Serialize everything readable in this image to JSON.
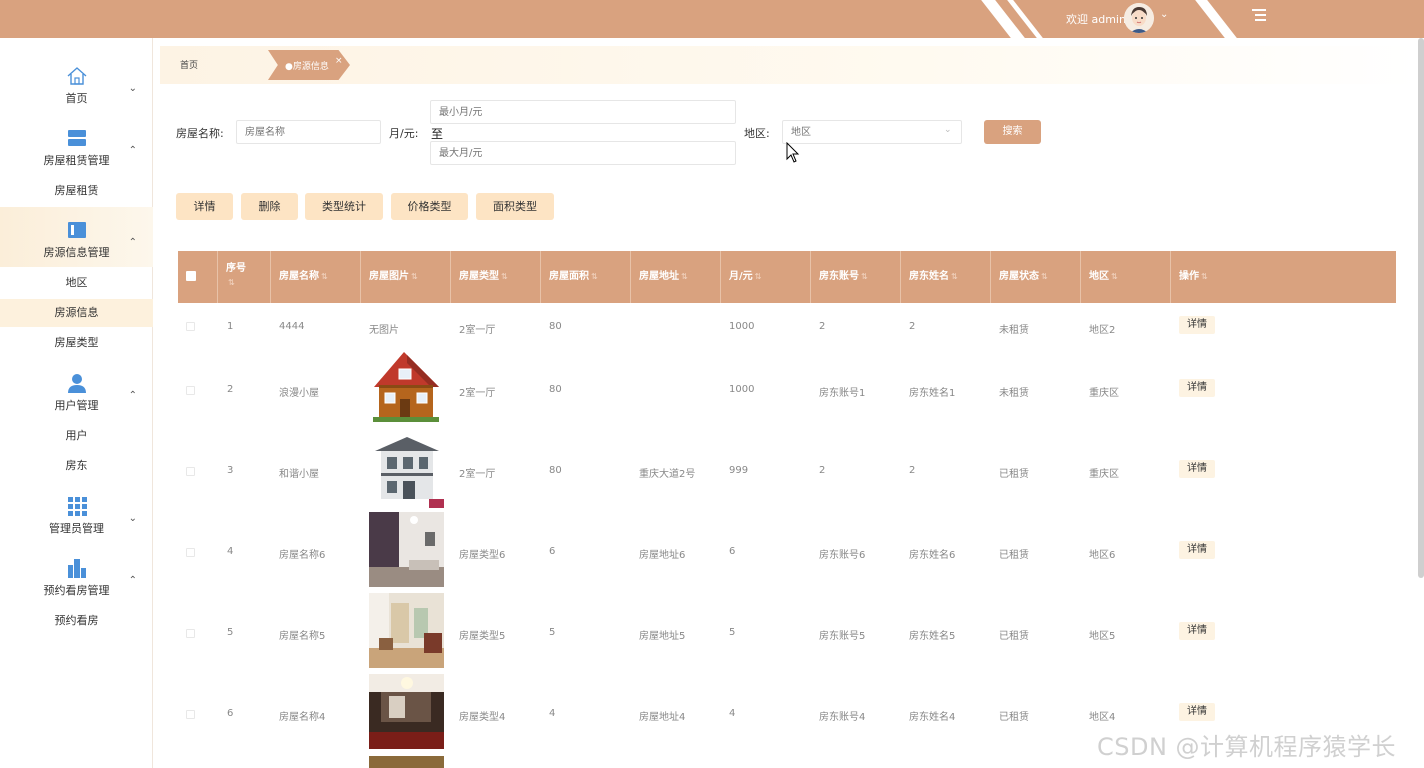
{
  "header": {
    "welcome": "欢迎 admin",
    "accent_color": "#d9a27f"
  },
  "sidebar": {
    "groups": [
      {
        "label": "首页",
        "icon": "home-icon",
        "chevron": "down"
      },
      {
        "label": "房屋租赁管理",
        "icon": "database-icon",
        "chevron": "up",
        "items": [
          "房屋租赁"
        ]
      },
      {
        "label": "房源信息管理",
        "icon": "panel-icon",
        "chevron": "up",
        "items": [
          "地区",
          "房源信息",
          "房屋类型"
        ],
        "active_item": "房源信息"
      },
      {
        "label": "用户管理",
        "icon": "user-icon",
        "chevron": "up",
        "items": [
          "用户",
          "房东"
        ]
      },
      {
        "label": "管理员管理",
        "icon": "grid-icon",
        "chevron": "down"
      },
      {
        "label": "预约看房管理",
        "icon": "building-icon",
        "chevron": "up",
        "items": [
          "预约看房"
        ]
      }
    ]
  },
  "breadcrumb": {
    "home": "首页",
    "current": "●房源信息",
    "close": "×"
  },
  "search": {
    "name_label": "房屋名称:",
    "name_placeholder": "房屋名称",
    "price_label": "月/元:",
    "min_placeholder": "最小月/元",
    "to": "至",
    "max_placeholder": "最大月/元",
    "region_label": "地区:",
    "region_placeholder": "地区",
    "button": "搜索"
  },
  "actions": [
    "详情",
    "删除",
    "类型统计",
    "价格类型",
    "面积类型"
  ],
  "table": {
    "columns": [
      "序号",
      "房屋名称",
      "房屋图片",
      "房屋类型",
      "房屋面积",
      "房屋地址",
      "月/元",
      "房东账号",
      "房东姓名",
      "房屋状态",
      "地区",
      "操作"
    ],
    "action_label": "详情",
    "rows": [
      {
        "no": "1",
        "name": "4444",
        "image": "无图片",
        "type": "2室一厅",
        "area": "80",
        "address": "",
        "price": "1000",
        "account": "2",
        "owner": "2",
        "status": "未租赁",
        "region": "地区2"
      },
      {
        "no": "2",
        "name": "浪漫小屋",
        "image": "house-image",
        "type": "2室一厅",
        "area": "80",
        "address": "",
        "price": "1000",
        "account": "房东账号1",
        "owner": "房东姓名1",
        "status": "未租赁",
        "region": "重庆区"
      },
      {
        "no": "3",
        "name": "和谐小屋",
        "image": "villa-image",
        "type": "2室一厅",
        "area": "80",
        "address": "重庆大道2号",
        "price": "999",
        "account": "2",
        "owner": "2",
        "status": "已租赁",
        "region": "重庆区"
      },
      {
        "no": "4",
        "name": "房屋名称6",
        "image": "room-image",
        "type": "房屋类型6",
        "area": "6",
        "address": "房屋地址6",
        "price": "6",
        "account": "房东账号6",
        "owner": "房东姓名6",
        "status": "已租赁",
        "region": "地区6"
      },
      {
        "no": "5",
        "name": "房屋名称5",
        "image": "room-image",
        "type": "房屋类型5",
        "area": "5",
        "address": "房屋地址5",
        "price": "5",
        "account": "房东账号5",
        "owner": "房东姓名5",
        "status": "已租赁",
        "region": "地区5"
      },
      {
        "no": "6",
        "name": "房屋名称4",
        "image": "room-image",
        "type": "房屋类型4",
        "area": "4",
        "address": "房屋地址4",
        "price": "4",
        "account": "房东账号4",
        "owner": "房东姓名4",
        "status": "已租赁",
        "region": "地区4"
      }
    ]
  },
  "watermark": "CSDN @计算机程序猿学长"
}
